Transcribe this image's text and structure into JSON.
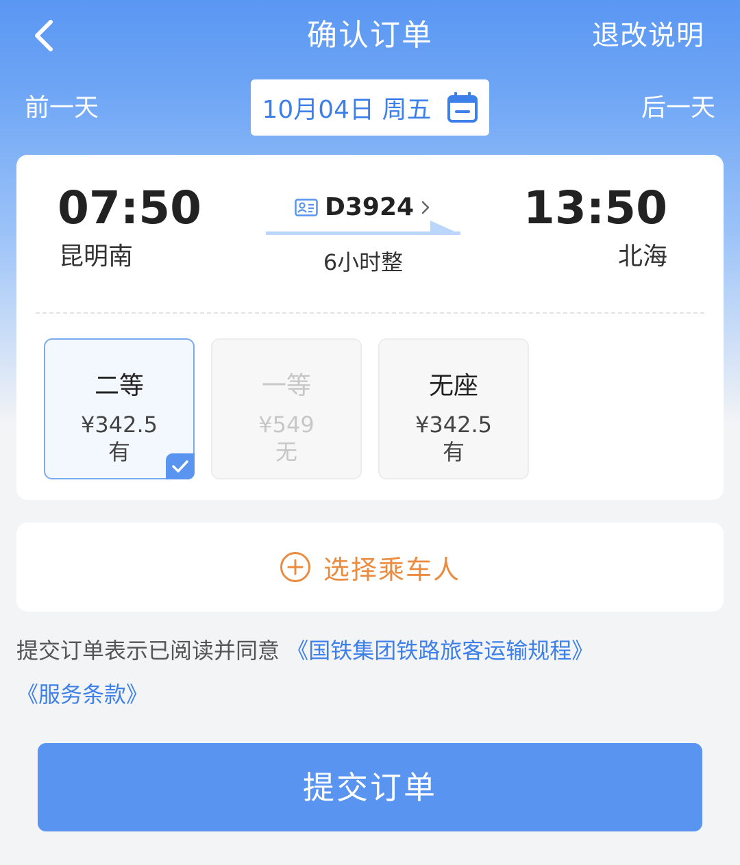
{
  "header": {
    "title": "确认订单",
    "refund_rules": "退改说明",
    "prev_day": "前一天",
    "next_day": "后一天",
    "date": "10月04日 周五"
  },
  "train": {
    "departure_time": "07:50",
    "departure_station": "昆明南",
    "arrival_time": "13:50",
    "arrival_station": "北海",
    "train_number": "D3924",
    "duration": "6小时整"
  },
  "seats": [
    {
      "name": "二等",
      "price": "¥342.5",
      "availability": "有",
      "selected": true,
      "disabled": false
    },
    {
      "name": "一等",
      "price": "¥549",
      "availability": "无",
      "selected": false,
      "disabled": true
    },
    {
      "name": "无座",
      "price": "¥342.5",
      "availability": "有",
      "selected": false,
      "disabled": false
    }
  ],
  "passenger": {
    "add_label": "选择乘车人"
  },
  "agreement": {
    "prefix": "提交订单表示已阅读并同意",
    "link1": "《国铁集团铁路旅客运输规程》",
    "link2": "《服务条款》"
  },
  "submit_label": "提交订单",
  "colors": {
    "primary": "#5894f0",
    "accent_orange": "#ea8b3f",
    "link_blue": "#3e80ea"
  }
}
